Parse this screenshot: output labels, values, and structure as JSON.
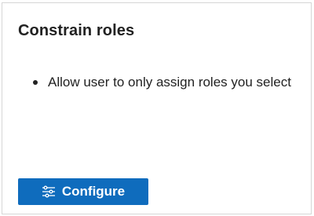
{
  "card": {
    "title": "Constrain roles",
    "bullets": [
      "Allow user to only assign roles you select"
    ],
    "configure_button": {
      "label": "Configure",
      "icon": "sliders-icon"
    }
  },
  "colors": {
    "button_background": "#0f6cbd",
    "button_text": "#ffffff",
    "text": "#222222",
    "card_border": "#d6d6d6"
  }
}
